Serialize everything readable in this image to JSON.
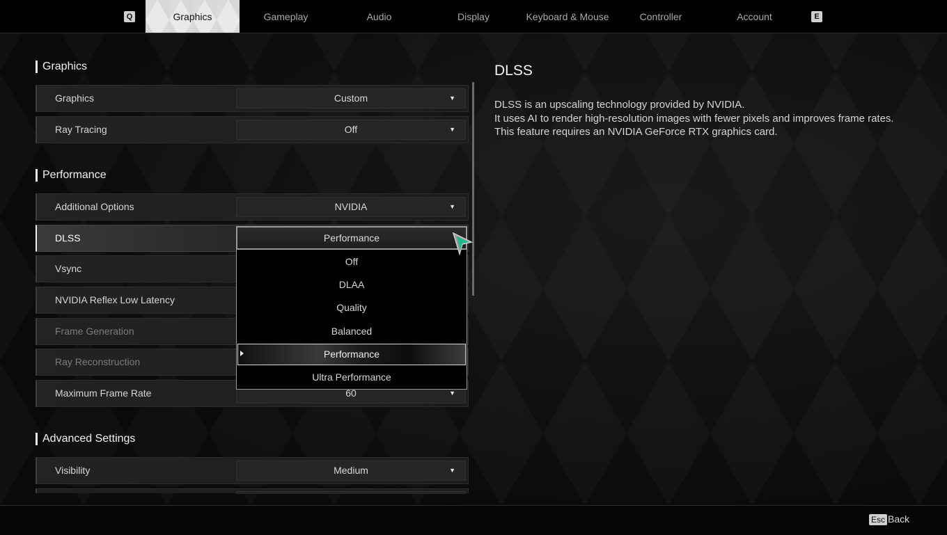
{
  "nav": {
    "prev_key": "Q",
    "next_key": "E",
    "tabs": [
      {
        "label": "Graphics",
        "active": true
      },
      {
        "label": "Gameplay",
        "active": false
      },
      {
        "label": "Audio",
        "active": false
      },
      {
        "label": "Display",
        "active": false
      },
      {
        "label": "Keyboard & Mouse",
        "active": false
      },
      {
        "label": "Controller",
        "active": false
      },
      {
        "label": "Account",
        "active": false
      }
    ]
  },
  "sections": {
    "graphics": {
      "title": "Graphics",
      "rows": [
        {
          "label": "Graphics",
          "value": "Custom"
        },
        {
          "label": "Ray Tracing",
          "value": "Off"
        }
      ]
    },
    "performance": {
      "title": "Performance",
      "rows": [
        {
          "label": "Additional Options",
          "value": "NVIDIA"
        },
        {
          "label": "DLSS",
          "value": "Performance"
        },
        {
          "label": "Vsync",
          "value": ""
        },
        {
          "label": "NVIDIA Reflex Low Latency",
          "value": ""
        },
        {
          "label": "Frame Generation",
          "value": ""
        },
        {
          "label": "Ray Reconstruction",
          "value": ""
        },
        {
          "label": "Maximum Frame Rate",
          "value": "60"
        }
      ]
    },
    "advanced": {
      "title": "Advanced Settings",
      "rows": [
        {
          "label": "Visibility",
          "value": "Medium"
        }
      ]
    }
  },
  "dropdown": {
    "current": "Performance",
    "options": [
      "Off",
      "DLAA",
      "Quality",
      "Balanced",
      "Performance",
      "Ultra Performance"
    ],
    "highlighted_index": 4
  },
  "description": {
    "title": "DLSS",
    "lines": [
      "DLSS is an upscaling technology provided by NVIDIA.",
      "It uses AI to render high-resolution images with fewer pixels and improves frame rates.",
      "This feature requires an NVIDIA GeForce RTX graphics card."
    ]
  },
  "footer": {
    "back_key": "Esc",
    "back_label": "Back"
  },
  "icons": {
    "dropdown_arrow": "▼"
  }
}
